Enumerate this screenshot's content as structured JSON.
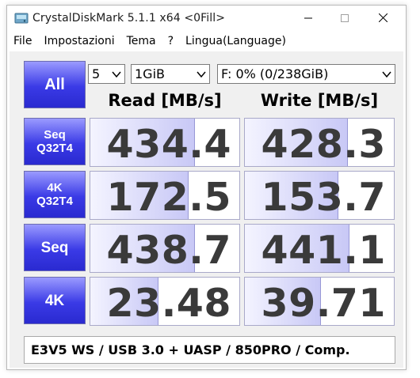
{
  "window": {
    "title": "CrystalDiskMark 5.1.1 x64 <0Fill>",
    "accent": "#3a3ae6"
  },
  "menu": [
    {
      "label": "File"
    },
    {
      "label": "Impostazioni"
    },
    {
      "label": "Tema"
    },
    {
      "label": "?"
    },
    {
      "label": "Lingua(Language)"
    }
  ],
  "controls": {
    "all_label": "All",
    "count": "5",
    "size": "1GiB",
    "drive": "F: 0% (0/238GiB)"
  },
  "headers": {
    "read": "Read [MB/s]",
    "write": "Write [MB/s]"
  },
  "tests": [
    {
      "line1": "Seq",
      "line2": "Q32T4",
      "read": "434.4",
      "write": "428.3",
      "read_fill": 0.7,
      "write_fill": 0.69
    },
    {
      "line1": "4K",
      "line2": "Q32T4",
      "read": "172.5",
      "write": "153.7",
      "read_fill": 0.66,
      "write_fill": 0.63
    },
    {
      "line1": "Seq",
      "line2": "",
      "read": "438.7",
      "write": "441.1",
      "read_fill": 0.7,
      "write_fill": 0.7
    },
    {
      "line1": "4K",
      "line2": "",
      "read": "23.48",
      "write": "39.71",
      "read_fill": 0.46,
      "write_fill": 0.51
    }
  ],
  "comment": "E3V5 WS / USB 3.0 + UASP / 850PRO / Comp."
}
